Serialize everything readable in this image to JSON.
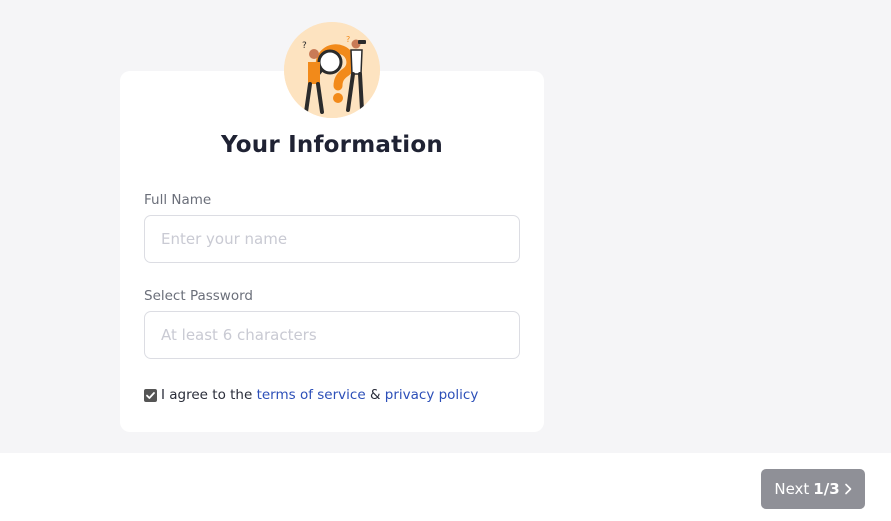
{
  "form": {
    "title": "Your Information",
    "full_name": {
      "label": "Full Name",
      "placeholder": "Enter your name",
      "value": ""
    },
    "password": {
      "label": "Select Password",
      "placeholder": "At least 6 characters",
      "value": ""
    },
    "agree": {
      "checked": true,
      "prefix": "I agree to the",
      "terms_link": "terms of service",
      "conjunction": "&",
      "privacy_link": "privacy policy"
    }
  },
  "footer": {
    "next_label": "Next",
    "step": "1/3",
    "next_icon": "chevron-right-icon"
  },
  "illustration": {
    "icon": "question-search-illustration",
    "bg_color": "#fde3c0",
    "accent_color": "#f28a1a"
  },
  "colors": {
    "page_bg": "#f5f5f7",
    "link": "#2c4fb8",
    "button_bg": "#8f9097"
  }
}
